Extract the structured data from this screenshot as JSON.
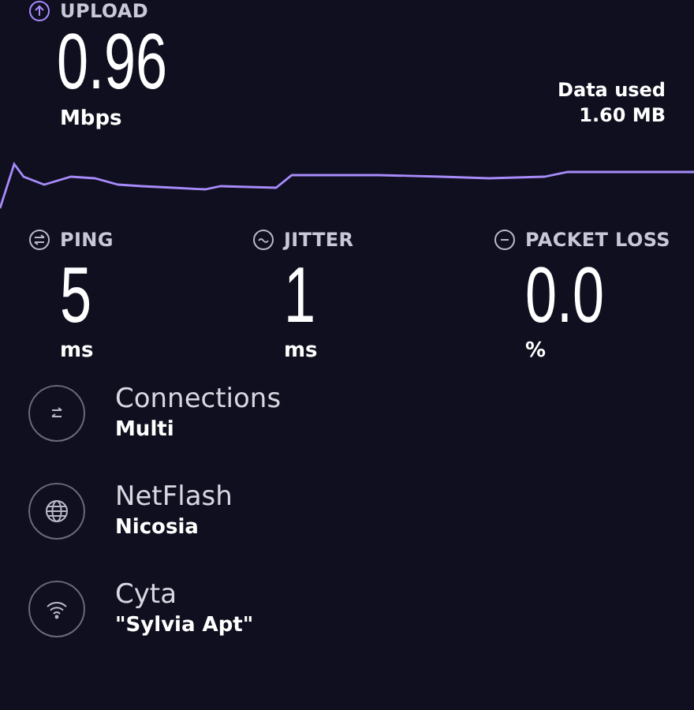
{
  "upload": {
    "label": "UPLOAD",
    "value": "0.96",
    "unit": "Mbps"
  },
  "data_used": {
    "label": "Data used",
    "value": "1.60 MB"
  },
  "stats": [
    {
      "kind": "ping",
      "label": "PING",
      "value": "5",
      "unit": "ms"
    },
    {
      "kind": "jitter",
      "label": "JITTER",
      "value": "1",
      "unit": "ms"
    },
    {
      "kind": "loss",
      "label": "PACKET LOSS",
      "value": "0.0",
      "unit": "%"
    }
  ],
  "details": [
    {
      "kind": "connections",
      "title": "Connections",
      "subtitle": "Multi"
    },
    {
      "kind": "server",
      "title": "NetFlash",
      "subtitle": "Nicosia"
    },
    {
      "kind": "wifi",
      "title": "Cyta",
      "subtitle": "\"Sylvia Apt\""
    }
  ]
}
